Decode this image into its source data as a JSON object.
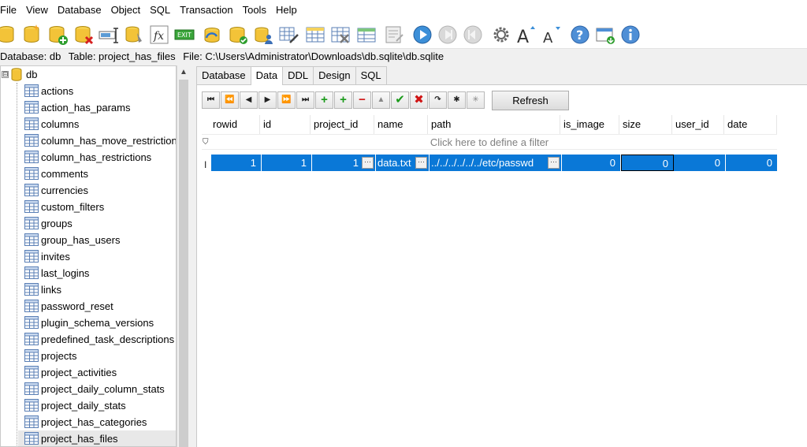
{
  "menu": [
    "File",
    "View",
    "Database",
    "Object",
    "SQL",
    "Transaction",
    "Tools",
    "Help"
  ],
  "pathbar": {
    "database_label": "Database: db",
    "table_label": "Table: project_has_files",
    "file_label": "File: C:\\Users\\Administrator\\Downloads\\db.sqlite\\db.sqlite"
  },
  "tree": {
    "root": "db",
    "toggle": "⊟",
    "items": [
      "actions",
      "action_has_params",
      "columns",
      "column_has_move_restrictions",
      "column_has_restrictions",
      "comments",
      "currencies",
      "custom_filters",
      "groups",
      "group_has_users",
      "invites",
      "last_logins",
      "links",
      "password_reset",
      "plugin_schema_versions",
      "predefined_task_descriptions",
      "projects",
      "project_activities",
      "project_daily_column_stats",
      "project_daily_stats",
      "project_has_categories",
      "project_has_files"
    ],
    "selected": "project_has_files"
  },
  "tabs": [
    "Database",
    "Data",
    "DDL",
    "Design",
    "SQL"
  ],
  "active_tab": "Data",
  "nav_buttons": [
    "⏮",
    "⏪",
    "◀",
    "▶",
    "⏩",
    "⏭",
    "+",
    "+",
    "−",
    "▲",
    "✔",
    "✖",
    "↷",
    "✱",
    "✳"
  ],
  "refresh_label": "Refresh",
  "grid": {
    "columns": [
      "rowid",
      "id",
      "project_id",
      "name",
      "path",
      "is_image",
      "size",
      "user_id",
      "date"
    ],
    "filter_placeholder": "Click here to define a filter",
    "row": {
      "rowid": "1",
      "id": "1",
      "project_id": "1",
      "name": "data.txt",
      "path": "../../../../../../etc/passwd",
      "is_image": "0",
      "size": "0",
      "user_id": "0",
      "date": "0"
    },
    "row_indicator": "I",
    "ellipsis": "···"
  },
  "colors": {
    "selection": "#0a78d7",
    "toolbar_accent": "#3c8fd8"
  },
  "toolbar_icons": [
    "open-database-icon",
    "new-database-icon",
    "attach-database-icon",
    "detach-database-icon",
    "rename-icon",
    "vacuum-icon",
    "function-icon",
    "exit-icon",
    "refresh-db-icon",
    "check-db-icon",
    "user-db-icon",
    "table-edit-icon",
    "new-table-icon",
    "delete-table-icon",
    "new-view-icon",
    "sql-editor-icon",
    "run-icon",
    "stop-icon",
    "step-icon",
    "settings-icon",
    "font-larger-icon",
    "font-smaller-icon",
    "help-icon",
    "update-icon",
    "info-icon"
  ]
}
